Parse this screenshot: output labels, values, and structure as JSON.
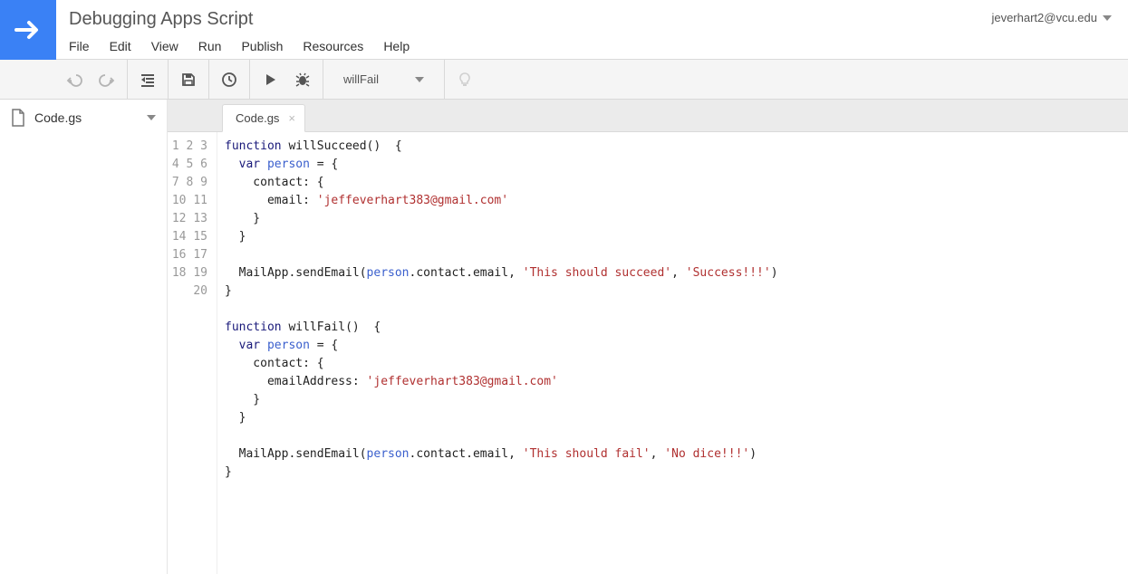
{
  "header": {
    "title": "Debugging Apps Script",
    "user": "jeverhart2@vcu.edu",
    "menu": [
      "File",
      "Edit",
      "View",
      "Run",
      "Publish",
      "Resources",
      "Help"
    ]
  },
  "toolbar": {
    "function_selected": "willFail"
  },
  "sidebar": {
    "file": "Code.gs"
  },
  "tab": {
    "label": "Code.gs"
  },
  "code": {
    "lines": 20,
    "fn1_name": "willSucceed",
    "fn2_name": "willFail",
    "key_email": "email",
    "key_emailAddress": "emailAddress",
    "key_contact": "contact",
    "var_person": "person",
    "kw_function": "function",
    "kw_var": "var",
    "email_str": "'jeffeverhart383@gmail.com'",
    "call_obj": "MailApp",
    "call_fn": "sendEmail",
    "call_arg_chain": ".contact.email",
    "subj1": "'This should succeed'",
    "body1": "'Success!!!'",
    "subj2": "'This should fail'",
    "body2": "'No dice!!!'"
  }
}
